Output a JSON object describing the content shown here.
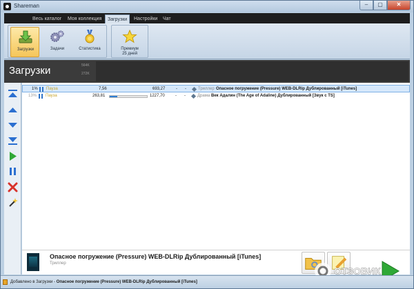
{
  "window": {
    "title": "Shareman",
    "min": "‒",
    "max": "▢",
    "close": "✕"
  },
  "menu": {
    "tabs": [
      "Весь каталог",
      "Моя коллекция",
      "Загрузки",
      "Настройки",
      "Чат"
    ],
    "active": "Загрузки"
  },
  "ribbon": {
    "downloads": "Загрузки",
    "tasks": "Задачи",
    "stats": "Статистика",
    "premium_line1": "Премиум",
    "premium_line2": "25 дней"
  },
  "header": {
    "title": "Загрузки",
    "speed_top": "564K",
    "speed_bottom": "272K"
  },
  "downloads": [
    {
      "percent": "1%",
      "status": "Пауза",
      "downloaded": "7,56",
      "size": "693,27",
      "progress": 0.01,
      "dash1": "-",
      "dash2": "-",
      "genre": "Триллер",
      "title": "Опасное погружение (Pressure) WEB-DLRip Дублированный [iTunes]"
    },
    {
      "percent": "13%",
      "status": "Пауза",
      "downloaded": "263,81",
      "size": "1227,70",
      "progress": 0.21,
      "dash1": "-",
      "dash2": "-",
      "genre": "Драма",
      "title": "Век Адалин (The Age of Adaline) Дублированный [Звук с TS]"
    }
  ],
  "selected": {
    "title": "Опасное погружение (Pressure) WEB-DLRip Дублированный [iTunes]",
    "genre": "Триллер"
  },
  "statusbar": {
    "prefix": "Добавлено в Загрузки - ",
    "item": "Опасное погружение (Pressure) WEB-DLRip Дублированный [iTunes]"
  },
  "watermark": "ОТЗОВИК",
  "colors": {
    "accent_blue": "#2f7fd4",
    "pause_yellow": "#c8a42b",
    "header_dark": "#3b3b3b",
    "play_green": "#2fa836",
    "delete_red": "#d8332b"
  }
}
